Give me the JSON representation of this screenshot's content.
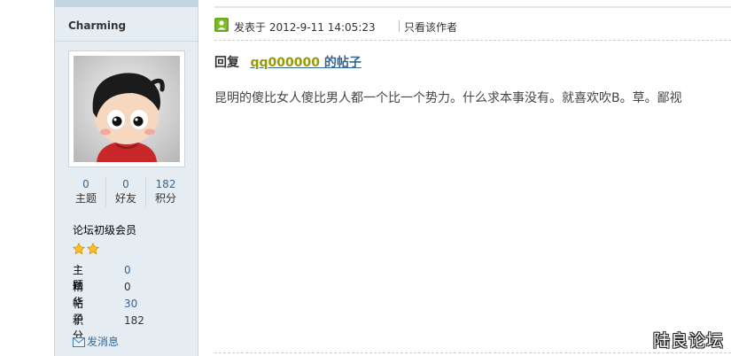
{
  "author": {
    "name": "Charming",
    "stats": [
      {
        "value": "0",
        "label": "主题"
      },
      {
        "value": "0",
        "label": "好友"
      },
      {
        "value": "182",
        "label": "积分"
      }
    ],
    "rank": "论坛初级会员",
    "star_count": 2,
    "info": [
      {
        "key": "主题",
        "value": "0"
      },
      {
        "key": "精华",
        "value": "0"
      },
      {
        "key": "帖子",
        "value": "30"
      },
      {
        "key": "积分",
        "value": "182"
      }
    ],
    "pm_label": "发消息"
  },
  "post": {
    "time_text": "发表于  2012-9-11 14:05:23",
    "only_author_label": "只看该作者",
    "reply_lead": "回复",
    "reply_user": "qq000000",
    "reply_suffix": " 的帖子",
    "content": "昆明的傻比女人傻比男人都一个比一个势力。什么求本事没有。就喜欢吹B。草。鄙视"
  },
  "watermark": "陆良论坛",
  "colors": {
    "sidebar_bg": "#e5edf2",
    "link": "#336699",
    "username": "#999900"
  }
}
